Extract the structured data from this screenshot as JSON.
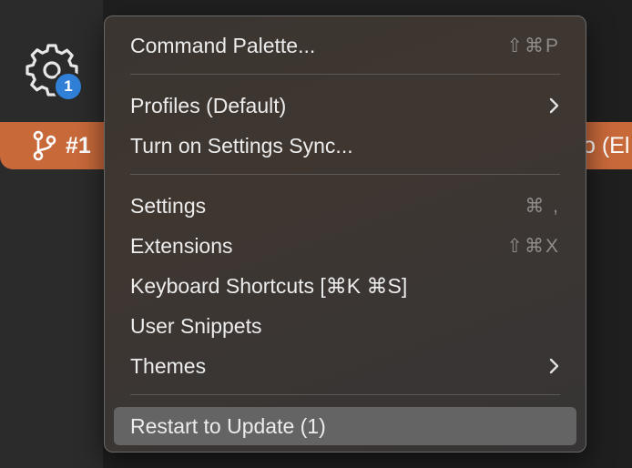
{
  "activity_bar": {
    "gear_badge": "1"
  },
  "status_bar": {
    "branch_ref": "#1",
    "right_text": "o (El"
  },
  "menu": {
    "items": [
      {
        "label": "Command Palette...",
        "shortcut": "⇧⌘P"
      },
      {
        "label": "Profiles (Default)",
        "submenu": true
      },
      {
        "label": "Turn on Settings Sync..."
      },
      {
        "label": "Settings",
        "shortcut": "⌘ ,"
      },
      {
        "label": "Extensions",
        "shortcut": "⇧⌘X"
      },
      {
        "label": "Keyboard Shortcuts [⌘K ⌘S]"
      },
      {
        "label": "User Snippets"
      },
      {
        "label": "Themes",
        "submenu": true
      },
      {
        "label": "Restart to Update (1)",
        "highlighted": true
      }
    ]
  },
  "colors": {
    "status_bar": "#c8693a",
    "badge": "#3080d8",
    "highlight": "#646464"
  }
}
